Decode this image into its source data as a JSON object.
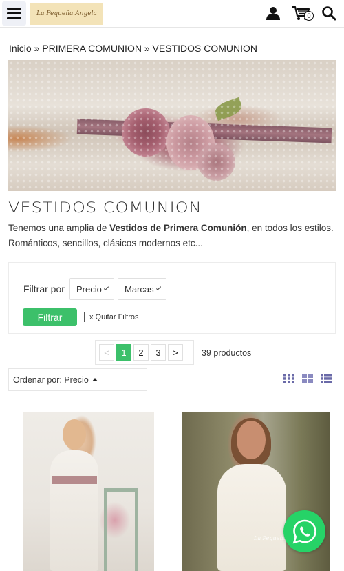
{
  "header": {
    "logo_text": "La Pequeña Angela",
    "icons": [
      "menu-icon",
      "user-icon",
      "cart-icon",
      "search-icon"
    ],
    "cart_count": "0"
  },
  "breadcrumb": {
    "items": [
      "Inicio",
      "PRIMERA COMUNION",
      "VESTIDOS COMUNION"
    ],
    "separator": "»"
  },
  "category": {
    "title": "VESTIDOS COMUNION",
    "description_intro": "Tenemos una amplia de ",
    "description_bold": "Vestidos de Primera Comunión",
    "description_rest": ", en todos los estilos. Románticos, sencillos, clásicos modernos etc..."
  },
  "filters": {
    "label": "Filtrar por",
    "dropdowns": [
      "Precio",
      "Marcas"
    ],
    "apply_label": "Filtrar",
    "clear_label": "x Quitar Filtros"
  },
  "pagination": {
    "prev": "<",
    "pages": [
      "1",
      "2",
      "3"
    ],
    "current_page": "1",
    "next": ">",
    "count_text": "39 productos"
  },
  "sort": {
    "label": "Ordenar por: Precio"
  },
  "view_modes": [
    "grid-small-icon",
    "grid-large-icon",
    "list-icon"
  ],
  "products": [
    {
      "watermark": ""
    },
    {
      "watermark": "La Pequeña A"
    }
  ],
  "colors": {
    "accent_green": "#3cc06a",
    "whatsapp_green": "#26d367",
    "view_icon": "#6a6aa8"
  }
}
